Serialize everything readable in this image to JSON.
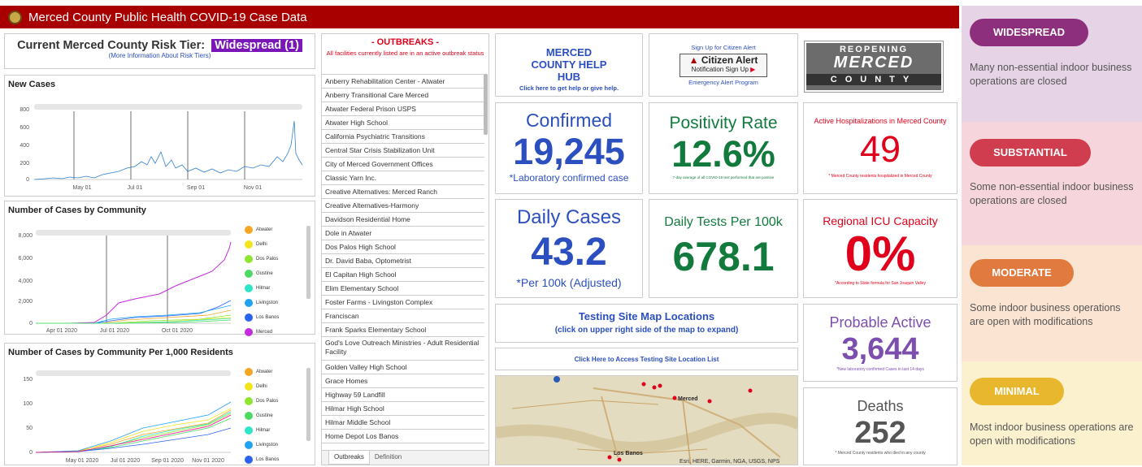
{
  "header": {
    "title": "Merced County Public Health COVID-19 Case Data"
  },
  "risk": {
    "label": "Current Merced County Risk Tier:",
    "tier": "Widespread (1)",
    "more_info": "(More Information About Risk Tiers)"
  },
  "new_cases_chart": {
    "title": "New Cases",
    "yticks": [
      "800",
      "600",
      "400",
      "200",
      "0"
    ],
    "xticks": [
      "May 01",
      "Jul 01",
      "Sep 01",
      "Nov 01"
    ]
  },
  "community_chart": {
    "title": "Number of Cases by Community",
    "yticks": [
      "8,000",
      "6,000",
      "4,000",
      "2,000",
      "0"
    ],
    "xticks": [
      "Apr 01 2020",
      "Jul 01 2020",
      "Oct 01 2020"
    ],
    "legend": [
      "Atwater",
      "Delhi",
      "Dos Palos",
      "Gustine",
      "Hilmar",
      "Livingston",
      "Los Banos",
      "Merced"
    ]
  },
  "per1000_chart": {
    "title": "Number of Cases by Community Per 1,000 Residents",
    "yticks": [
      "150",
      "100",
      "50",
      "0"
    ],
    "xticks": [
      "May 01 2020",
      "Jul 01 2020",
      "Sep 01 2020",
      "Nov 01 2020"
    ],
    "legend": [
      "Atwater",
      "Delhi",
      "Dos Palos",
      "Gustine",
      "Hilmar",
      "Livingston",
      "Los Banos"
    ]
  },
  "outbreaks": {
    "title": "- OUTBREAKS -",
    "subtitle": "All facilities currently listed are in an active outbreak status",
    "items": [
      "Anberry Rehabilitation Center - Atwater",
      "Anberry Transitional Care Merced",
      "Atwater Federal Prison USPS",
      "Atwater High School",
      "California Psychiatric Transitions",
      "Central Star Crisis Stabilization Unit",
      "City of Merced Government Offices",
      "Classic Yarn Inc.",
      "Creative Alternatives: Merced Ranch",
      "Creative Alternatives-Harmony",
      "Davidson Residential Home",
      "Dole in Atwater",
      "Dos Palos High School",
      "Dr. David Baba, Optometrist",
      "El Capitan High School",
      "Elim Elementary School",
      "Foster Farms - Livingston Complex",
      "Franciscan",
      "Frank Sparks Elementary School",
      "God's Love Outreach Ministries - Adult Residential Facility",
      "Golden Valley High School",
      "Grace Homes",
      "Highway 59 Landfill",
      "Hilmar High School",
      "Hilmar Middle School",
      "Home Depot Los Banos"
    ],
    "tabs": [
      "Outbreaks",
      "Definition"
    ]
  },
  "helphub": {
    "title": "MERCED COUNTY HELP HUB",
    "sub": "Click here to get help or give help."
  },
  "alert": {
    "top": "Sign Up for Citizen Alert",
    "logo": "Citizen Alert",
    "logo_sub": "Notification Sign Up",
    "bottom": "Emergency Alert Program"
  },
  "reopening": {
    "line1": "REOPENING",
    "line2": "MERCED",
    "line3": "COUNTY"
  },
  "confirmed": {
    "label": "Confirmed",
    "value": "19,245",
    "note": "*Laboratory confirmed case"
  },
  "positivity": {
    "label": "Positivity Rate",
    "value": "12.6%",
    "note": "7-day average of all COVID-19 test performed that are positive"
  },
  "hospital": {
    "label": "Active Hospitalizations in Merced County",
    "value": "49",
    "note": "* Merced County residents hospitalized in Merced County"
  },
  "daily_cases": {
    "label": "Daily Cases",
    "value": "43.2",
    "note": "*Per 100k (Adjusted)"
  },
  "daily_tests": {
    "label": "Daily Tests Per 100k",
    "value": "678.1"
  },
  "icu": {
    "label": "Regional ICU Capacity",
    "value": "0%",
    "note": "*According to State formula for San Joaquin Valley"
  },
  "testing_map": {
    "title": "Testing Site Map Locations",
    "sub": "(click on upper right side of the map to expand)"
  },
  "testing_list": {
    "link": "Click Here to Access Testing Site Location List"
  },
  "map": {
    "attribution": "Esri, HERE, Garmin, NGA, USGS, NPS",
    "labels": [
      "Merced",
      "Los Banos"
    ]
  },
  "probable": {
    "label": "Probable Active",
    "value": "3,644",
    "note": "*New laboratory confirmed Cases in last 14 days"
  },
  "deaths": {
    "label": "Deaths",
    "value": "252",
    "note": "* Merced County residents who died in any county"
  },
  "tiers": [
    {
      "name": "WIDESPREAD",
      "desc": "Many non-essential indoor business operations are closed",
      "bg": "#e6d3e5",
      "pill": "#8e2f7e"
    },
    {
      "name": "SUBSTANTIAL",
      "desc": "Some non-essential indoor business operations are closed",
      "bg": "#f6d6dc",
      "pill": "#cf3d4e"
    },
    {
      "name": "MODERATE",
      "desc": "Some indoor business operations are open with modifications",
      "bg": "#fbe4d2",
      "pill": "#e07a3f"
    },
    {
      "name": "MINIMAL",
      "desc": "Most indoor business operations are open with modifications",
      "bg": "#fcf1cf",
      "pill": "#e8b72e"
    }
  ],
  "colors": {
    "red": "#a80000",
    "blue": "#2b4fbf",
    "green": "#137a3e",
    "alert_red": "#e0001b",
    "purple": "#7c4fae",
    "gray": "#555555"
  },
  "legend_colors": [
    "#f5a623",
    "#f3e51a",
    "#8ee62f",
    "#4cd964",
    "#2de6c8",
    "#1fa3f0",
    "#2a62f0",
    "#c42bdc"
  ]
}
